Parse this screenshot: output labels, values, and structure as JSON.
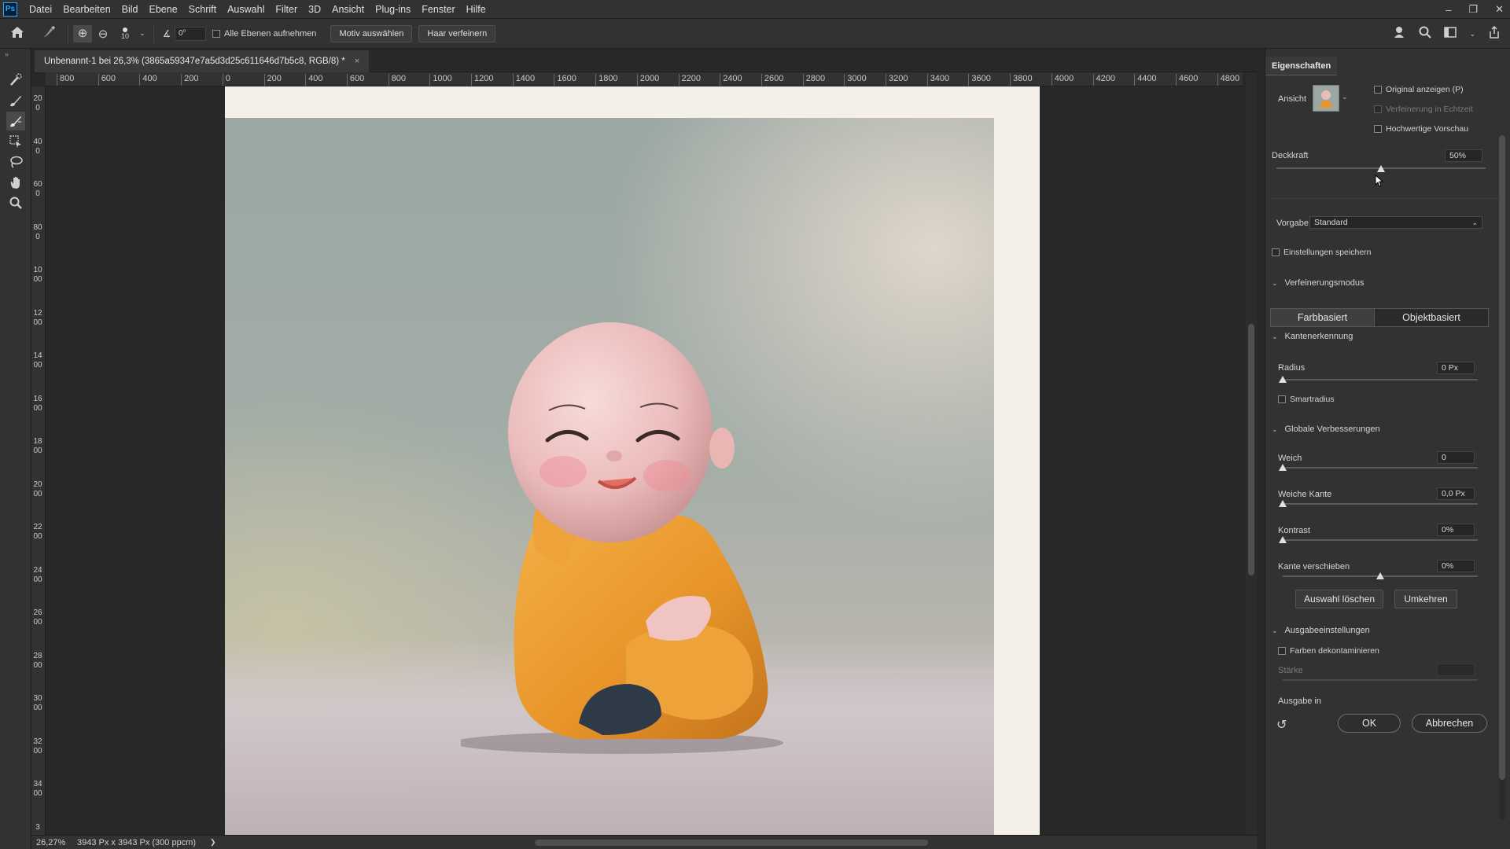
{
  "app": {
    "logo": "Ps"
  },
  "menu": [
    "Datei",
    "Bearbeiten",
    "Bild",
    "Ebene",
    "Schrift",
    "Auswahl",
    "Filter",
    "3D",
    "Ansicht",
    "Plug-ins",
    "Fenster",
    "Hilfe"
  ],
  "window_controls": {
    "minimize": "–",
    "restore": "❐",
    "close": "✕"
  },
  "options": {
    "brush_size": "10",
    "angle": "0°",
    "sample_all_layers": "Alle Ebenen aufnehmen",
    "select_subject": "Motiv auswählen",
    "refine_hair": "Haar verfeinern"
  },
  "document": {
    "tab_title": "Unbenannt-1 bei 26,3% (3865a59347e7a5d3d25c611646d7b5c8, RGB/8) *",
    "tab_close": "×"
  },
  "ruler_top": [
    "800",
    "600",
    "400",
    "200",
    "0",
    "200",
    "400",
    "600",
    "800",
    "1000",
    "1200",
    "1400",
    "1600",
    "1800",
    "2000",
    "2200",
    "2400",
    "2600",
    "2800",
    "3000",
    "3200",
    "3400",
    "3600",
    "3800",
    "4000",
    "4200",
    "4400",
    "4600",
    "4800"
  ],
  "ruler_left": [
    "200",
    "400",
    "600",
    "800",
    "1000",
    "1200",
    "1400",
    "1600",
    "1800",
    "2000",
    "2200",
    "2400",
    "2600",
    "2800",
    "3000",
    "3200",
    "3400",
    "3"
  ],
  "status": {
    "zoom": "26,27%",
    "dimensions": "3943 Px x 3943 Px (300 ppcm)",
    "arrow": "❯"
  },
  "panel": {
    "title": "Eigenschaften",
    "view_label": "Ansicht",
    "show_original": "Original anzeigen (P)",
    "realtime_refine": "Verfeinerung in Echtzeit",
    "hq_preview": "Hochwertige Vorschau",
    "opacity_label": "Deckkraft",
    "opacity_value": "50%",
    "opacity_level": 0.5,
    "preset_label": "Vorgabe",
    "preset_value": "Standard",
    "save_settings": "Einstellungen speichern",
    "refine_mode_section": "Verfeinerungsmodus",
    "mode_color": "Farbbasiert",
    "mode_object": "Objektbasiert",
    "edge_detection_section": "Kantenerkennung",
    "radius_label": "Radius",
    "radius_value": "0 Px",
    "smart_radius": "Smartradius",
    "global_section": "Globale Verbesserungen",
    "smooth_label": "Weich",
    "smooth_value": "0",
    "feather_label": "Weiche Kante",
    "feather_value": "0,0 Px",
    "contrast_label": "Kontrast",
    "contrast_value": "0%",
    "shift_edge_label": "Kante verschieben",
    "shift_edge_value": "0%",
    "clear_selection": "Auswahl löschen",
    "invert": "Umkehren",
    "output_section": "Ausgabeeinstellungen",
    "decontaminate": "Farben dekontaminieren",
    "amount_label": "Stärke",
    "output_to_label": "Ausgabe in",
    "ok": "OK",
    "cancel": "Abbrechen",
    "reset_icon": "↺"
  },
  "colors": {
    "ui_bg": "#323232",
    "canvas_bg": "#282828",
    "robe": "#e89a2a",
    "skin": "#e8b8b8"
  }
}
